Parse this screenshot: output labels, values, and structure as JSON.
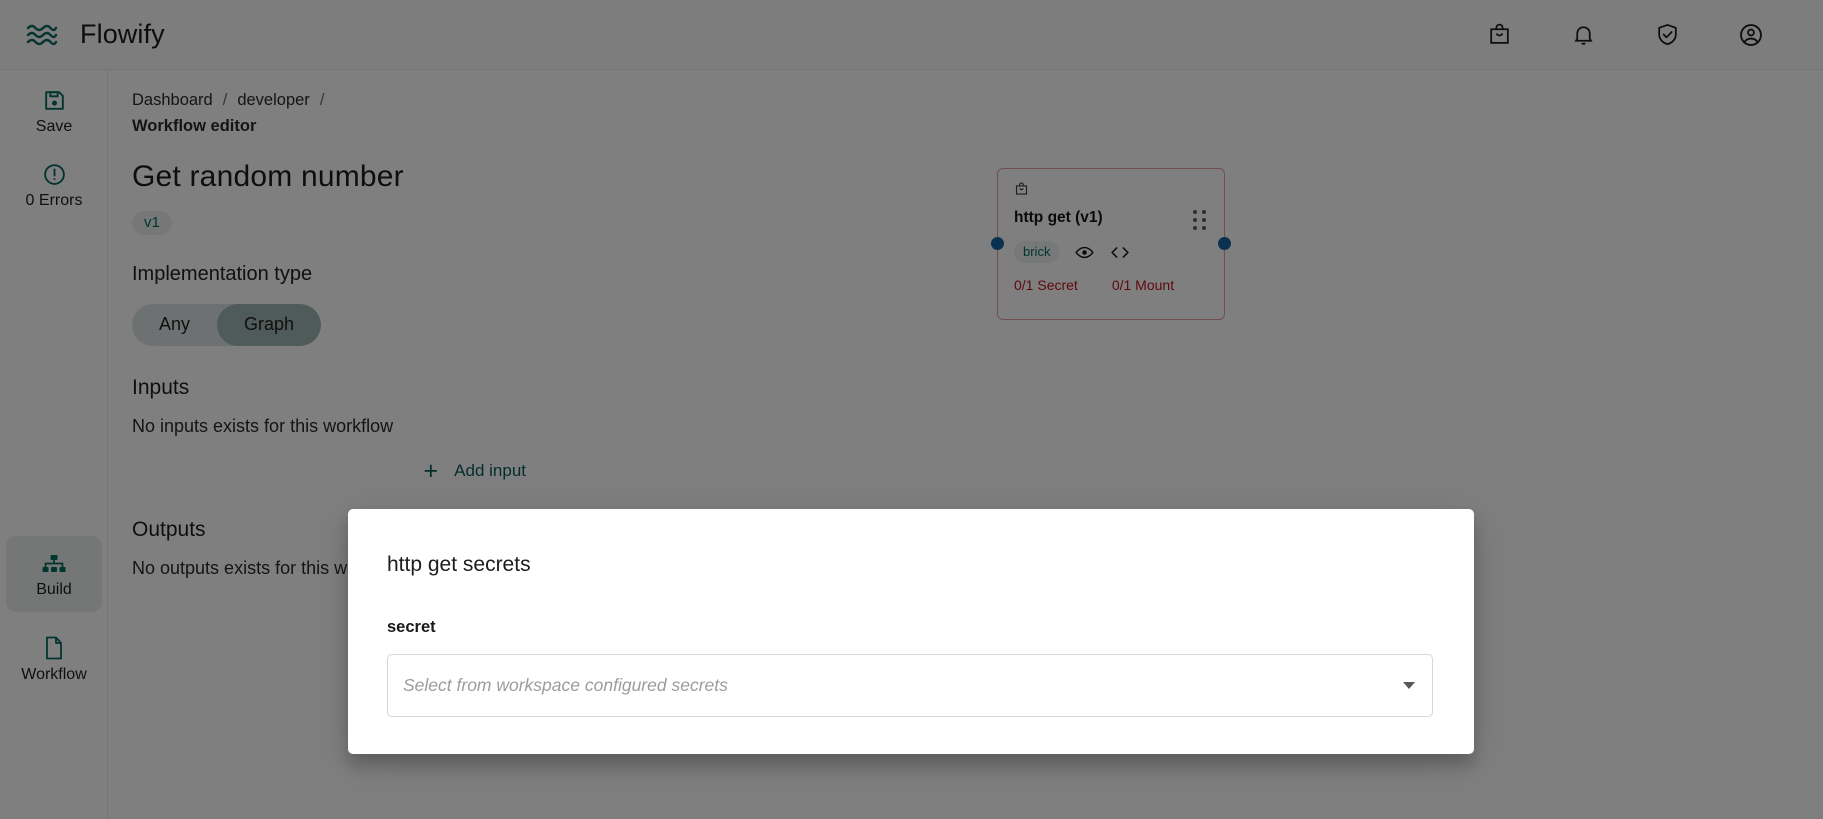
{
  "topbar": {
    "brand": "Flowify",
    "logo_icon": "waves-icon",
    "actions": [
      {
        "name": "marketplace-icon",
        "icon": "shopping-bag-icon"
      },
      {
        "name": "notifications-icon",
        "icon": "bell-icon"
      },
      {
        "name": "security-icon",
        "icon": "shield-check-icon"
      },
      {
        "name": "account-icon",
        "icon": "account-circle-icon"
      }
    ]
  },
  "rail": {
    "items": [
      {
        "label": "Save",
        "icon": "save-floppy-icon",
        "selected": false
      },
      {
        "label": "0 Errors",
        "icon": "error-circle-icon",
        "selected": false
      },
      {
        "label": "Build",
        "icon": "account-tree-icon",
        "selected": true
      },
      {
        "label": "Workflow",
        "icon": "document-icon",
        "selected": false
      }
    ]
  },
  "panel": {
    "breadcrumb": {
      "items": [
        "Dashboard",
        "developer"
      ],
      "separator": "/",
      "current": "Workflow editor"
    },
    "workflow_title": "Get random number",
    "version_chip": "v1",
    "implementation_type": {
      "label": "Implementation type",
      "options": [
        "Any",
        "Graph"
      ],
      "selected": "Graph"
    },
    "inputs": {
      "heading": "Inputs",
      "empty_text": "No inputs exists for this workflow",
      "add_label": "Add input",
      "add_icon": "plus-icon"
    },
    "outputs": {
      "heading": "Outputs",
      "empty_text": "No outputs exists for this workflow"
    }
  },
  "canvas": {
    "node": {
      "icon": "shopping-bag-icon",
      "title": "http get (v1)",
      "chip": "brick",
      "view_icon": "eye-icon",
      "code_icon": "code-brackets-icon",
      "drag_icon": "drag-handle-icon",
      "secret_stat": "0/1 Secret",
      "mount_stat": "0/1 Mount"
    }
  },
  "dialog": {
    "title": "http get secrets",
    "field_label": "secret",
    "select_placeholder": "Select from workspace configured secrets",
    "select_value": "",
    "caret_icon": "chevron-down-icon"
  },
  "colors": {
    "brand_teal": "#046a5d",
    "accent_link": "#0b5c57",
    "error_red": "#c1121f",
    "node_border": "#e3a0a0",
    "port_blue": "#1565a0",
    "toggle_selected": "#9fb6b2"
  }
}
